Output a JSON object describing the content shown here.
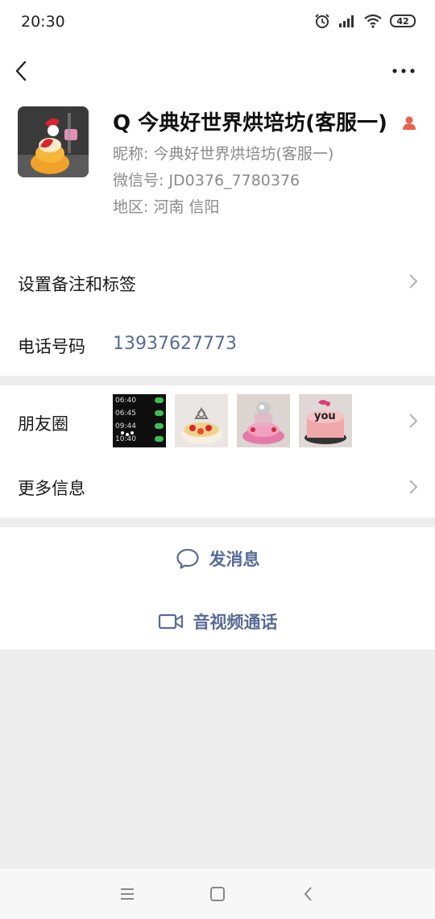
{
  "status_bar": {
    "time": "20:30",
    "battery": "42",
    "icons": [
      "alarm-icon",
      "signal-icon",
      "wifi-icon",
      "battery-icon"
    ]
  },
  "nav": {
    "back_icon": "chevron-left-icon",
    "more_icon": "more-dots-icon"
  },
  "profile": {
    "display_name": "Q 今典好世界烘培坊(客服一)",
    "nickname": "昵称: 今典好世界烘培坊(客服一)",
    "wechat_id": "微信号: JD0376_7780376",
    "region": "地区: 河南  信阳",
    "gender_icon": "person-icon",
    "accent_color": "#e8614d"
  },
  "rows": {
    "remarks_label": "设置备注和标签",
    "phone_label": "电话号码",
    "phone_value": "13937627773",
    "moments_label": "朋友圈",
    "more_info_label": "更多信息"
  },
  "moments_thumbs": {
    "thumb1_times": [
      "06:40",
      "06:45",
      "09:44",
      "10:40"
    ],
    "thumb4_text": "you"
  },
  "actions": {
    "message_label": "发消息",
    "video_call_label": "音视频通话",
    "link_color": "#576b95"
  },
  "bottom_nav": {
    "icons": [
      "menu-icon",
      "home-square-icon",
      "back-triangle-icon"
    ]
  }
}
